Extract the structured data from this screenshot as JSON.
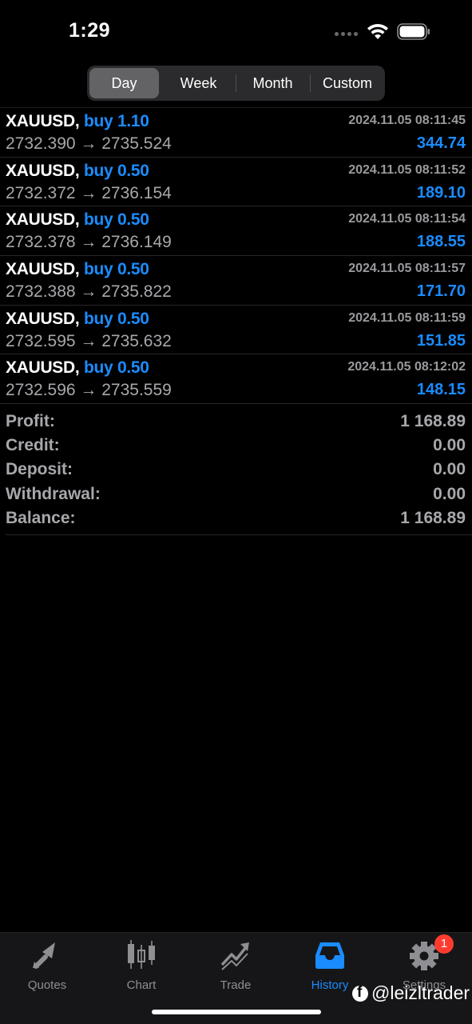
{
  "status_bar": {
    "time": "1:29"
  },
  "period_tabs": {
    "day": "Day",
    "week": "Week",
    "month": "Month",
    "custom": "Custom",
    "selected": "Day"
  },
  "deals": [
    {
      "symbol": "XAUUSD,",
      "type": "buy 1.10",
      "time": "2024.11.05 08:11:45",
      "prices": "2732.390 → 2735.524",
      "profit": "344.74"
    },
    {
      "symbol": "XAUUSD,",
      "type": "buy 0.50",
      "time": "2024.11.05 08:11:52",
      "prices": "2732.372 → 2736.154",
      "profit": "189.10"
    },
    {
      "symbol": "XAUUSD,",
      "type": "buy 0.50",
      "time": "2024.11.05 08:11:54",
      "prices": "2732.378 → 2736.149",
      "profit": "188.55"
    },
    {
      "symbol": "XAUUSD,",
      "type": "buy 0.50",
      "time": "2024.11.05 08:11:57",
      "prices": "2732.388 → 2735.822",
      "profit": "171.70"
    },
    {
      "symbol": "XAUUSD,",
      "type": "buy 0.50",
      "time": "2024.11.05 08:11:59",
      "prices": "2732.595 → 2735.632",
      "profit": "151.85"
    },
    {
      "symbol": "XAUUSD,",
      "type": "buy 0.50",
      "time": "2024.11.05 08:12:02",
      "prices": "2732.596 → 2735.559",
      "profit": "148.15"
    }
  ],
  "summary": {
    "profit_label": "Profit:",
    "profit_value": "1 168.89",
    "credit_label": "Credit:",
    "credit_value": "0.00",
    "deposit_label": "Deposit:",
    "deposit_value": "0.00",
    "withdrawal_label": "Withdrawal:",
    "withdrawal_value": "0.00",
    "balance_label": "Balance:",
    "balance_value": "1 168.89"
  },
  "tab_bar": {
    "quotes": "Quotes",
    "chart": "Chart",
    "trade": "Trade",
    "history": "History",
    "settings": "Settings",
    "settings_badge": "1",
    "active": "History"
  },
  "watermark": "@leizltrader",
  "colors": {
    "accent": "#1a8cff",
    "background": "#000000",
    "badge": "#ff3b30"
  }
}
